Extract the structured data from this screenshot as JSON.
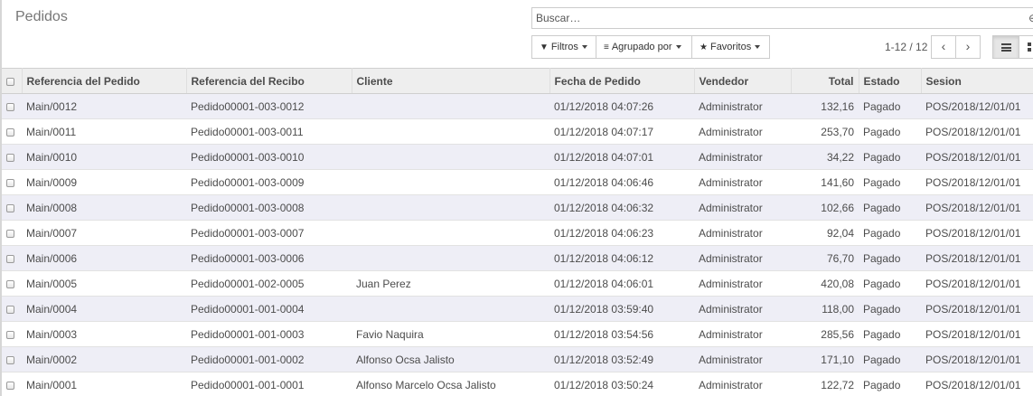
{
  "control_panel": {
    "title": "Pedidos",
    "search": {
      "placeholder": "Buscar…",
      "options_icon": "search-options-icon"
    },
    "buttons": {
      "filters": {
        "label": "Filtros",
        "icon": "filter-icon"
      },
      "group_by": {
        "label": "Agrupado por",
        "icon": "bars-icon"
      },
      "favorites": {
        "label": "Favoritos",
        "icon": "star-icon"
      }
    },
    "pager": {
      "value": "1-12 / 12",
      "prev_icon": "chevron-left-icon",
      "next_icon": "chevron-right-icon"
    },
    "views": [
      {
        "icon": "list-view-icon",
        "active": true
      },
      {
        "icon": "kanban-view-icon",
        "active": false
      }
    ]
  },
  "table": {
    "columns": [
      "Referencia del Pedido",
      "Referencia del Recibo",
      "Cliente",
      "Fecha de Pedido",
      "Vendedor",
      "Total",
      "Estado",
      "Sesion"
    ],
    "rows": [
      {
        "ref": "Main/0012",
        "receipt": "Pedido00001-003-0012",
        "client": "",
        "date": "01/12/2018 04:07:26",
        "seller": "Administrator",
        "total": "132,16",
        "state": "Pagado",
        "session": "POS/2018/12/01/01"
      },
      {
        "ref": "Main/0011",
        "receipt": "Pedido00001-003-0011",
        "client": "",
        "date": "01/12/2018 04:07:17",
        "seller": "Administrator",
        "total": "253,70",
        "state": "Pagado",
        "session": "POS/2018/12/01/01"
      },
      {
        "ref": "Main/0010",
        "receipt": "Pedido00001-003-0010",
        "client": "",
        "date": "01/12/2018 04:07:01",
        "seller": "Administrator",
        "total": "34,22",
        "state": "Pagado",
        "session": "POS/2018/12/01/01"
      },
      {
        "ref": "Main/0009",
        "receipt": "Pedido00001-003-0009",
        "client": "",
        "date": "01/12/2018 04:06:46",
        "seller": "Administrator",
        "total": "141,60",
        "state": "Pagado",
        "session": "POS/2018/12/01/01"
      },
      {
        "ref": "Main/0008",
        "receipt": "Pedido00001-003-0008",
        "client": "",
        "date": "01/12/2018 04:06:32",
        "seller": "Administrator",
        "total": "102,66",
        "state": "Pagado",
        "session": "POS/2018/12/01/01"
      },
      {
        "ref": "Main/0007",
        "receipt": "Pedido00001-003-0007",
        "client": "",
        "date": "01/12/2018 04:06:23",
        "seller": "Administrator",
        "total": "92,04",
        "state": "Pagado",
        "session": "POS/2018/12/01/01"
      },
      {
        "ref": "Main/0006",
        "receipt": "Pedido00001-003-0006",
        "client": "",
        "date": "01/12/2018 04:06:12",
        "seller": "Administrator",
        "total": "76,70",
        "state": "Pagado",
        "session": "POS/2018/12/01/01"
      },
      {
        "ref": "Main/0005",
        "receipt": "Pedido00001-002-0005",
        "client": "Juan Perez",
        "date": "01/12/2018 04:06:01",
        "seller": "Administrator",
        "total": "420,08",
        "state": "Pagado",
        "session": "POS/2018/12/01/01"
      },
      {
        "ref": "Main/0004",
        "receipt": "Pedido00001-001-0004",
        "client": "",
        "date": "01/12/2018 03:59:40",
        "seller": "Administrator",
        "total": "118,00",
        "state": "Pagado",
        "session": "POS/2018/12/01/01"
      },
      {
        "ref": "Main/0003",
        "receipt": "Pedido00001-001-0003",
        "client": "Favio Naquira",
        "date": "01/12/2018 03:54:56",
        "seller": "Administrator",
        "total": "285,56",
        "state": "Pagado",
        "session": "POS/2018/12/01/01"
      },
      {
        "ref": "Main/0002",
        "receipt": "Pedido00001-001-0002",
        "client": "Alfonso Ocsa Jalisto",
        "date": "01/12/2018 03:52:49",
        "seller": "Administrator",
        "total": "171,10",
        "state": "Pagado",
        "session": "POS/2018/12/01/01"
      },
      {
        "ref": "Main/0001",
        "receipt": "Pedido00001-001-0001",
        "client": "Alfonso Marcelo Ocsa Jalisto",
        "date": "01/12/2018 03:50:24",
        "seller": "Administrator",
        "total": "122,72",
        "state": "Pagado",
        "session": "POS/2018/12/01/01"
      }
    ]
  },
  "colors": {
    "header_bg": "#eeeeee",
    "odd_row_bg": "#eeeef6",
    "text": "#4c4c4c",
    "border": "#cccccc"
  }
}
